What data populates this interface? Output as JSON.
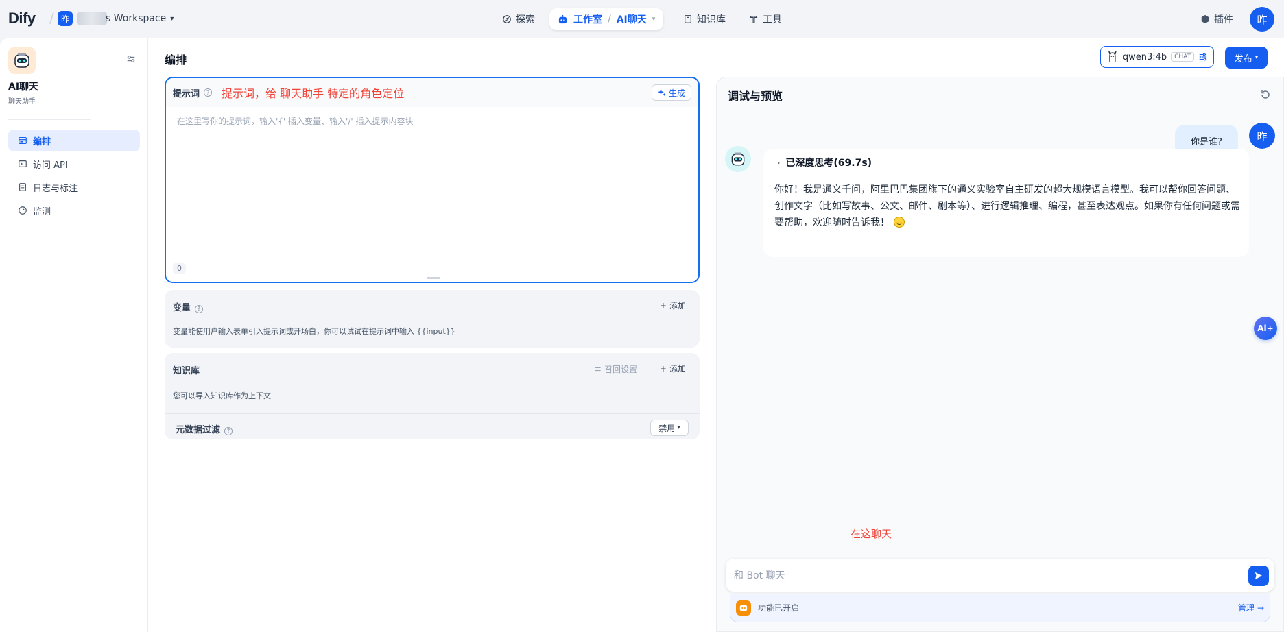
{
  "topbar": {
    "logo": "Dify",
    "workspace_avatar": "昨",
    "workspace_name": "s Workspace",
    "nav": [
      {
        "label": "探索",
        "icon": "compass-icon"
      },
      {
        "label": "工作室",
        "icon": "robot-icon"
      },
      {
        "label": "AI聊天",
        "icon": "chevron-down-icon"
      },
      {
        "label": "知识库",
        "icon": "book-icon"
      },
      {
        "label": "工具",
        "icon": "hammer-icon"
      }
    ],
    "plugin_label": "插件",
    "user_avatar": "昨"
  },
  "sidebar": {
    "app_name": "AI聊天",
    "app_subtitle": "聊天助手",
    "items": [
      {
        "label": "编排",
        "icon": "layout-icon",
        "active": true
      },
      {
        "label": "访问 API",
        "icon": "terminal-icon",
        "active": false
      },
      {
        "label": "日志与标注",
        "icon": "document-icon",
        "active": false
      },
      {
        "label": "监测",
        "icon": "gauge-icon",
        "active": false
      }
    ]
  },
  "main": {
    "page_title": "编排",
    "model_name": "qwen3:4b",
    "model_tag": "CHAT",
    "publish_label": "发布"
  },
  "prompt": {
    "label": "提示词",
    "annotation": "提示词，给 聊天助手 特定的角色定位",
    "generate_label": "生成",
    "placeholder": "在这里写你的提示词，输入'{' 插入变量、输入'/' 插入提示内容块",
    "count": "0"
  },
  "variables": {
    "title": "变量",
    "add_label": "添加",
    "description": "变量能使用户输入表单引入提示词或开场白，你可以试试在提示词中输入 {{input}}"
  },
  "knowledge": {
    "title": "知识库",
    "recall_label": "召回设置",
    "add_label": "添加",
    "description": "您可以导入知识库作为上下文",
    "meta_filter_label": "元数据过滤",
    "meta_filter_value": "禁用"
  },
  "debug": {
    "title": "调试与预览",
    "user_message": "你是谁?",
    "user_avatar": "昨",
    "thinking_label": "已深度思考(69.7s)",
    "bot_reply": "你好！我是通义千问，阿里巴巴集团旗下的通义实验室自主研发的超大规模语言模型。我可以帮你回答问题、创作文字（比如写故事、公文、邮件、剧本等）、进行逻辑推理、编程，甚至表达观点。如果你有任何问题或需要帮助，欢迎随时告诉我！",
    "ai_float_label": "Ai+",
    "chat_annotation": "在这聊天",
    "input_placeholder": "和 Bot 聊天",
    "feature_text": "功能已开启",
    "manage_label": "管理"
  },
  "colors": {
    "accent": "#155eef",
    "annotation_red": "#f04438",
    "feature_orange": "#f79009"
  }
}
